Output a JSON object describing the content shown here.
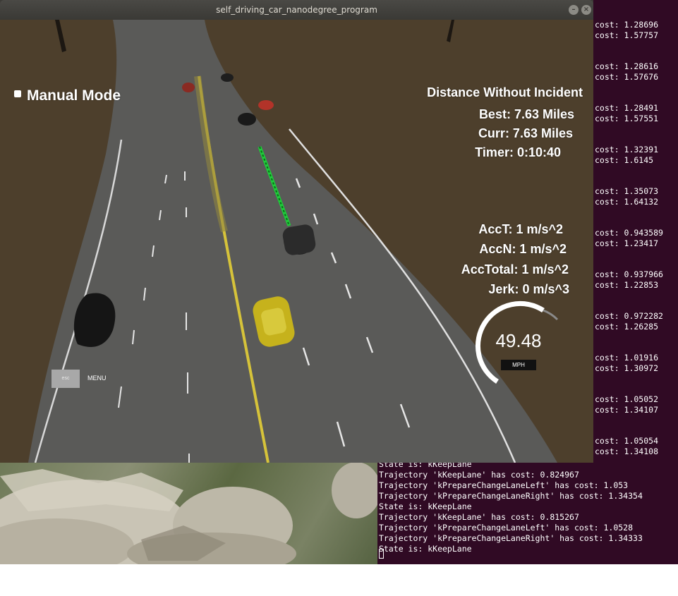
{
  "window": {
    "title": "self_driving_car_nanodegree_program",
    "minimize_glyph": "–",
    "close_glyph": "×"
  },
  "hud": {
    "mode": "Manual Mode",
    "distance_title": "Distance Without Incident",
    "best": "Best: 7.63 Miles",
    "curr": "Curr: 7.63 Miles",
    "timer": "Timer: 0:10:40",
    "acc_t": "AccT: 1 m/s^2",
    "acc_n": "AccN: 1 m/s^2",
    "acc_total": "AccTotal: 1 m/s^2",
    "jerk": "Jerk: 0 m/s^3",
    "speed": "49.48",
    "speed_unit": "MPH",
    "speedometer_fill": 0.65,
    "esc_label": "esc",
    "menu_label": "MENU"
  },
  "terminal": {
    "side_costs": [
      "cost: 1.28696",
      "cost: 1.57757",
      "cost: 1.28616",
      "cost: 1.57676",
      "cost: 1.28491",
      "cost: 1.57551",
      "cost: 1.32391",
      "cost: 1.6145",
      "cost: 1.35073",
      "cost: 1.64132",
      "cost: 0.943589",
      "cost: 1.23417",
      "cost: 0.937966",
      "cost: 1.22853",
      "cost: 0.972282",
      "cost: 1.26285",
      "cost: 1.01916",
      "cost: 1.30972",
      "cost: 1.05052",
      "cost: 1.34107",
      "cost: 1.05054",
      "cost: 1.34108"
    ],
    "bottom_lines": [
      "State is: kKeepLane",
      "Trajectory 'kKeepLane' has cost: 0.824967",
      "Trajectory 'kPrepareChangeLaneLeft' has cost: 1.053",
      "Trajectory 'kPrepareChangeLaneRight' has cost: 1.34354",
      "State is: kKeepLane",
      "Trajectory 'kKeepLane' has cost: 0.815267",
      "Trajectory 'kPrepareChangeLaneLeft' has cost: 1.0528",
      "Trajectory 'kPrepareChangeLaneRight' has cost: 1.34333",
      "State is: kKeepLane"
    ]
  }
}
